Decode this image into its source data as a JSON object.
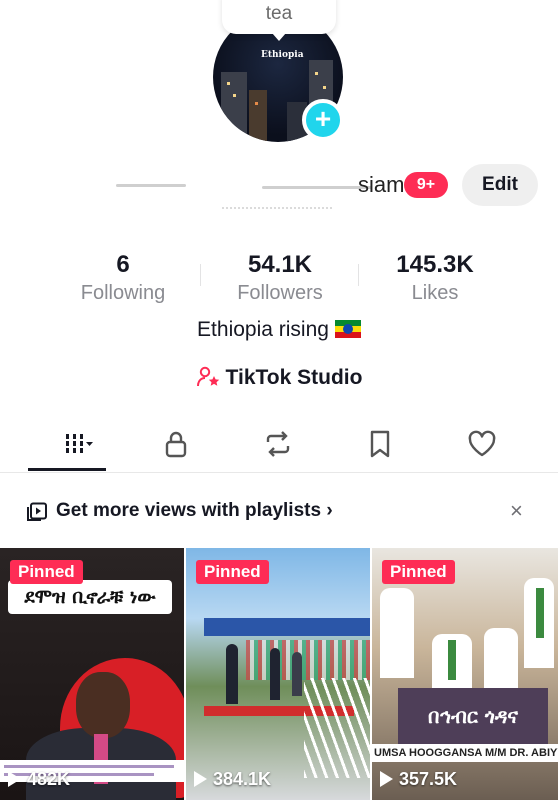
{
  "header": {
    "tea_bubble": "tea",
    "avatar_tag": "Ethiopia",
    "name_visible_fragment": "siam",
    "notification_badge": "9+",
    "edit_label": "Edit"
  },
  "stats": {
    "following": {
      "value": "6",
      "label": "Following"
    },
    "followers": {
      "value": "54.1K",
      "label": "Followers"
    },
    "likes": {
      "value": "145.3K",
      "label": "Likes"
    }
  },
  "bio": "Ethiopia rising",
  "studio_label": "TikTok Studio",
  "tabs": [
    {
      "icon": "videos-grid-icon"
    },
    {
      "icon": "lock-icon"
    },
    {
      "icon": "repost-icon"
    },
    {
      "icon": "bookmark-icon"
    },
    {
      "icon": "heart-icon"
    }
  ],
  "playlist_banner": {
    "text": "Get more views with playlists",
    "chevron": "›",
    "close": "×"
  },
  "videos": [
    {
      "pinned": "Pinned",
      "views": "482K",
      "caption": "ደሞዝ ቢኖራቹ ነው"
    },
    {
      "pinned": "Pinned",
      "views": "384.1K"
    },
    {
      "pinned": "Pinned",
      "views": "357.5K",
      "banner": "በኅብር ጎዳና",
      "ticker": "UMSA  HOOGGANSA M/M DR. ABIYYI AHM"
    }
  ],
  "colors": {
    "accent": "#fe2c55",
    "plus": "#20d5ec",
    "text": "#161823",
    "muted": "#8a8b91"
  }
}
